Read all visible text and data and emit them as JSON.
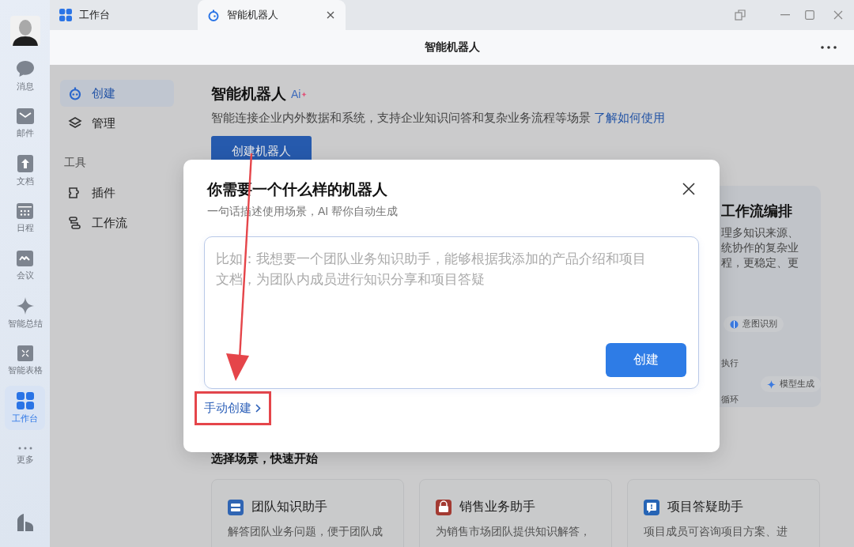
{
  "rail": {
    "items": [
      {
        "label": "消息",
        "selected": false
      },
      {
        "label": "邮件",
        "selected": false
      },
      {
        "label": "文档",
        "selected": false
      },
      {
        "label": "日程",
        "selected": false
      },
      {
        "label": "会议",
        "selected": false
      },
      {
        "label": "智能总结",
        "selected": false
      },
      {
        "label": "智能表格",
        "selected": false
      },
      {
        "label": "工作台",
        "selected": true
      },
      {
        "label": "更多",
        "selected": false
      }
    ]
  },
  "tabs": [
    {
      "label": "工作台",
      "selected": false,
      "closable": false
    },
    {
      "label": "智能机器人",
      "selected": true,
      "closable": true
    }
  ],
  "header": {
    "title": "智能机器人"
  },
  "nav": {
    "items": [
      {
        "label": "创建",
        "selected": true
      },
      {
        "label": "管理",
        "selected": false
      }
    ],
    "section_label": "工具",
    "tools": [
      {
        "label": "插件",
        "selected": false
      },
      {
        "label": "工作流",
        "selected": false
      }
    ]
  },
  "page": {
    "title": "智能机器人",
    "badge": "Ai",
    "description": "智能连接企业内外数据和系统，支持企业知识问答和复杂业务流程等场景",
    "link": "了解如何使用",
    "button": "创建机器人"
  },
  "feature_card": {
    "title": "工作流编排",
    "lines": [
      "理多知识来源、",
      "统协作的复杂业",
      "程，更稳定、更"
    ],
    "nodes": [
      "意图识别",
      "执行",
      "模型生成",
      "循环"
    ]
  },
  "scenarios": {
    "heading": "选择场景，快速开始",
    "cards": [
      {
        "title": "团队知识助手",
        "description": "解答团队业务问题，便于团队成",
        "color": "#3065b3"
      },
      {
        "title": "销售业务助手",
        "description": "为销售市场团队提供知识解答，",
        "color": "#a33a32"
      },
      {
        "title": "项目答疑助手",
        "description": "项目成员可咨询项目方案、进",
        "color": "#2664b5"
      }
    ]
  },
  "dialog": {
    "title": "你需要一个什么样的机器人",
    "subtitle": "一句话描述使用场景，AI 帮你自动生成",
    "placeholder": "比如：我想要一个团队业务知识助手，能够根据我添加的产品介绍和项目文档，为团队内成员进行知识分享和项目答疑",
    "submit": "创建",
    "manual_link": "手动创建",
    "highlighted": true
  },
  "annotation_arrow": true
}
